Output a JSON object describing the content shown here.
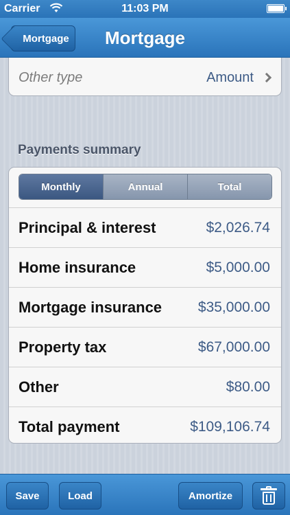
{
  "status_bar": {
    "carrier": "Carrier",
    "time": "11:03 PM"
  },
  "nav": {
    "back_label": "Mortgage",
    "title": "Mortgage"
  },
  "other_type": {
    "label": "Other type",
    "value": "Amount"
  },
  "summary": {
    "title": "Payments summary",
    "segments": [
      "Monthly",
      "Annual",
      "Total"
    ],
    "selected_segment": "Monthly",
    "rows": [
      {
        "label": "Principal & interest",
        "value": "$2,026.74"
      },
      {
        "label": "Home insurance",
        "value": "$5,000.00"
      },
      {
        "label": "Mortgage insurance",
        "value": "$35,000.00"
      },
      {
        "label": "Property tax",
        "value": "$67,000.00"
      },
      {
        "label": "Other",
        "value": "$80.00"
      },
      {
        "label": "Total payment",
        "value": "$109,106.74"
      }
    ]
  },
  "toolbar": {
    "save": "Save",
    "load": "Load",
    "amortize": "Amortize",
    "trash_icon": "trash-icon"
  },
  "colors": {
    "bar_blue": "#2a74ba",
    "value_blue": "#3d5b86",
    "segment_selected": "#3b5781"
  }
}
